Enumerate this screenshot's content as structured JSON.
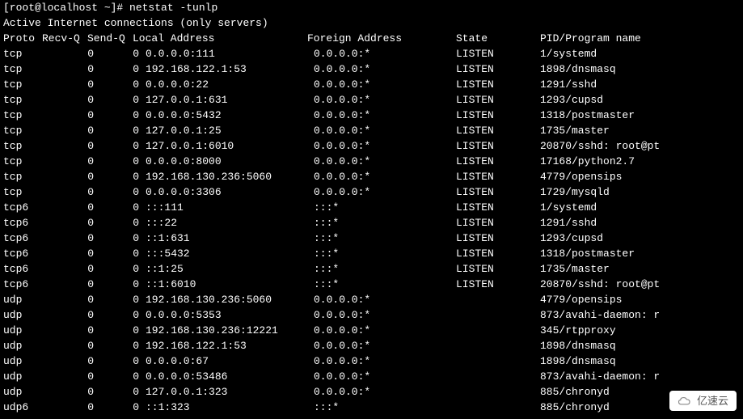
{
  "prompt": "[root@localhost ~]# ",
  "command": "netstat -tunlp",
  "banner": "Active Internet connections (only servers)",
  "headers": {
    "proto": "Proto",
    "recvq": "Recv-Q",
    "sendq": "Send-Q",
    "local": "Local Address",
    "foreign": "Foreign Address",
    "state": "State",
    "pid": "PID/Program name"
  },
  "rows": [
    {
      "proto": "tcp",
      "recvq": "0",
      "sendq": "0",
      "local": "0.0.0.0:111",
      "foreign": "0.0.0.0:*",
      "state": "LISTEN",
      "pid": "1/systemd"
    },
    {
      "proto": "tcp",
      "recvq": "0",
      "sendq": "0",
      "local": "192.168.122.1:53",
      "foreign": "0.0.0.0:*",
      "state": "LISTEN",
      "pid": "1898/dnsmasq"
    },
    {
      "proto": "tcp",
      "recvq": "0",
      "sendq": "0",
      "local": "0.0.0.0:22",
      "foreign": "0.0.0.0:*",
      "state": "LISTEN",
      "pid": "1291/sshd"
    },
    {
      "proto": "tcp",
      "recvq": "0",
      "sendq": "0",
      "local": "127.0.0.1:631",
      "foreign": "0.0.0.0:*",
      "state": "LISTEN",
      "pid": "1293/cupsd"
    },
    {
      "proto": "tcp",
      "recvq": "0",
      "sendq": "0",
      "local": "0.0.0.0:5432",
      "foreign": "0.0.0.0:*",
      "state": "LISTEN",
      "pid": "1318/postmaster"
    },
    {
      "proto": "tcp",
      "recvq": "0",
      "sendq": "0",
      "local": "127.0.0.1:25",
      "foreign": "0.0.0.0:*",
      "state": "LISTEN",
      "pid": "1735/master"
    },
    {
      "proto": "tcp",
      "recvq": "0",
      "sendq": "0",
      "local": "127.0.0.1:6010",
      "foreign": "0.0.0.0:*",
      "state": "LISTEN",
      "pid": "20870/sshd: root@pt"
    },
    {
      "proto": "tcp",
      "recvq": "0",
      "sendq": "0",
      "local": "0.0.0.0:8000",
      "foreign": "0.0.0.0:*",
      "state": "LISTEN",
      "pid": "17168/python2.7"
    },
    {
      "proto": "tcp",
      "recvq": "0",
      "sendq": "0",
      "local": "192.168.130.236:5060",
      "foreign": "0.0.0.0:*",
      "state": "LISTEN",
      "pid": "4779/opensips"
    },
    {
      "proto": "tcp",
      "recvq": "0",
      "sendq": "0",
      "local": "0.0.0.0:3306",
      "foreign": "0.0.0.0:*",
      "state": "LISTEN",
      "pid": "1729/mysqld"
    },
    {
      "proto": "tcp6",
      "recvq": "0",
      "sendq": "0",
      "local": ":::111",
      "foreign": ":::*",
      "state": "LISTEN",
      "pid": "1/systemd"
    },
    {
      "proto": "tcp6",
      "recvq": "0",
      "sendq": "0",
      "local": ":::22",
      "foreign": ":::*",
      "state": "LISTEN",
      "pid": "1291/sshd"
    },
    {
      "proto": "tcp6",
      "recvq": "0",
      "sendq": "0",
      "local": "::1:631",
      "foreign": ":::*",
      "state": "LISTEN",
      "pid": "1293/cupsd"
    },
    {
      "proto": "tcp6",
      "recvq": "0",
      "sendq": "0",
      "local": ":::5432",
      "foreign": ":::*",
      "state": "LISTEN",
      "pid": "1318/postmaster"
    },
    {
      "proto": "tcp6",
      "recvq": "0",
      "sendq": "0",
      "local": "::1:25",
      "foreign": ":::*",
      "state": "LISTEN",
      "pid": "1735/master"
    },
    {
      "proto": "tcp6",
      "recvq": "0",
      "sendq": "0",
      "local": "::1:6010",
      "foreign": ":::*",
      "state": "LISTEN",
      "pid": "20870/sshd: root@pt"
    },
    {
      "proto": "udp",
      "recvq": "0",
      "sendq": "0",
      "local": "192.168.130.236:5060",
      "foreign": "0.0.0.0:*",
      "state": "",
      "pid": "4779/opensips"
    },
    {
      "proto": "udp",
      "recvq": "0",
      "sendq": "0",
      "local": "0.0.0.0:5353",
      "foreign": "0.0.0.0:*",
      "state": "",
      "pid": "873/avahi-daemon: r"
    },
    {
      "proto": "udp",
      "recvq": "0",
      "sendq": "0",
      "local": "192.168.130.236:12221",
      "foreign": "0.0.0.0:*",
      "state": "",
      "pid": "345/rtpproxy"
    },
    {
      "proto": "udp",
      "recvq": "0",
      "sendq": "0",
      "local": "192.168.122.1:53",
      "foreign": "0.0.0.0:*",
      "state": "",
      "pid": "1898/dnsmasq"
    },
    {
      "proto": "udp",
      "recvq": "0",
      "sendq": "0",
      "local": "0.0.0.0:67",
      "foreign": "0.0.0.0:*",
      "state": "",
      "pid": "1898/dnsmasq"
    },
    {
      "proto": "udp",
      "recvq": "0",
      "sendq": "0",
      "local": "0.0.0.0:53486",
      "foreign": "0.0.0.0:*",
      "state": "",
      "pid": "873/avahi-daemon: r"
    },
    {
      "proto": "udp",
      "recvq": "0",
      "sendq": "0",
      "local": "127.0.0.1:323",
      "foreign": "0.0.0.0:*",
      "state": "",
      "pid": "885/chronyd"
    },
    {
      "proto": "udp6",
      "recvq": "0",
      "sendq": "0",
      "local": "::1:323",
      "foreign": ":::*",
      "state": "",
      "pid": "885/chronyd"
    }
  ],
  "watermark": "亿速云"
}
